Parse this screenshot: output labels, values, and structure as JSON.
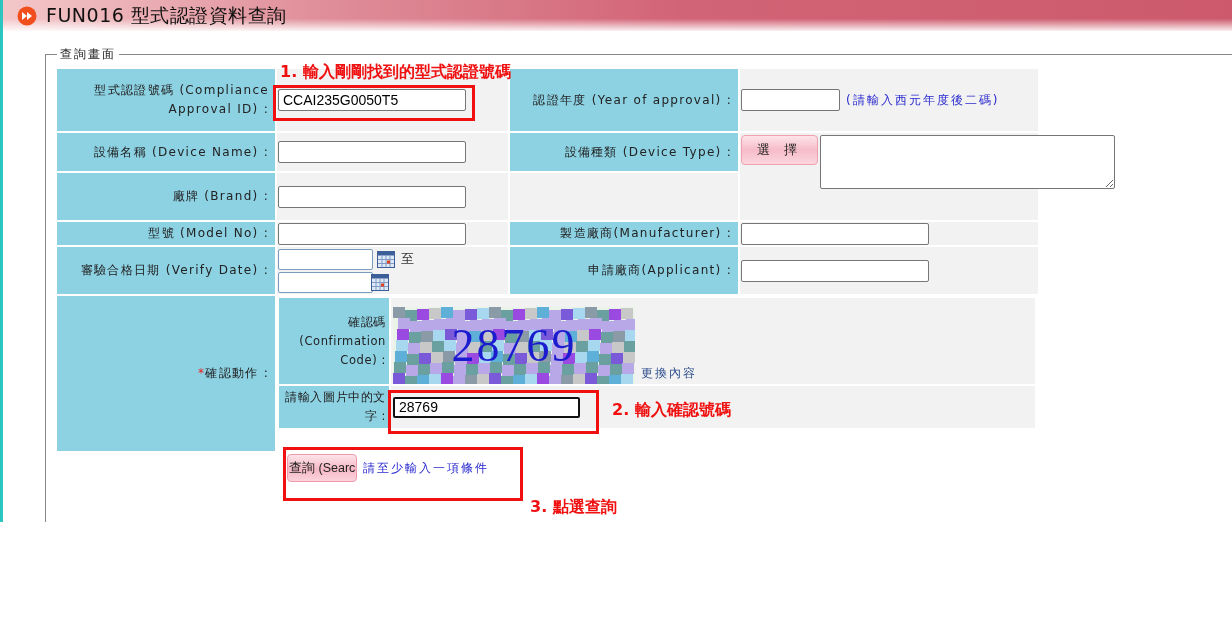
{
  "header": {
    "title": "FUN016 型式認證資料查詢"
  },
  "form": {
    "legend": "查詢畫面",
    "fields": [
      {
        "kind": "text",
        "label": "型式認證號碼 (Compliance Approval ID) :",
        "value": "CCAI235G0050T5"
      },
      {
        "kind": "text",
        "label": "認證年度 (Year of approval) :",
        "hint": "(請輸入西元年度後二碼)"
      },
      {
        "kind": "text",
        "label": "設備名稱 (Device Name) :"
      },
      {
        "kind": "picker",
        "label": "設備種類 (Device Type) :",
        "button": "選 擇"
      },
      {
        "kind": "text",
        "label": "廠牌 (Brand) :"
      },
      {
        "kind": "text",
        "label": "型號 (Model No) :"
      },
      {
        "kind": "text",
        "label": "製造廠商(Manufacturer) :"
      },
      {
        "kind": "date_range",
        "label": "審驗合格日期 (Verify Date) :",
        "separator": "至"
      },
      {
        "kind": "text",
        "label": "申請廠商(Applicant) :"
      }
    ],
    "confirm": {
      "required_mark": "*",
      "label": "確認動作 :",
      "code_label": "確認碼 (Confirmation Code) :",
      "captcha_text": "28769",
      "refresh_link": "更換內容",
      "input_label": "請輸入圖片中的文字 :",
      "input_value": "28769"
    },
    "search_button": "查詢 (Searc",
    "search_hint": "請至少輸入一項條件"
  },
  "annotations": [
    {
      "text": "1. 輸入剛剛找到的型式認證號碼"
    },
    {
      "text": "2. 輸入確認號碼"
    },
    {
      "text": "3. 點選查詢"
    }
  ]
}
